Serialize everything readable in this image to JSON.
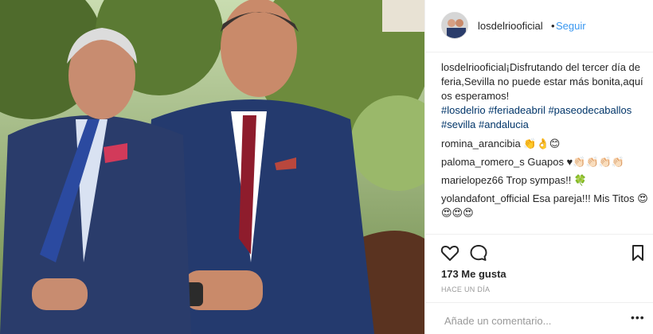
{
  "post": {
    "username": "losdelriooficial",
    "separator": "•",
    "follow_label": "Seguir",
    "caption_user": "losdelriooficial",
    "caption_text": "¡Disfrutando del tercer día de feria,Sevilla no puede estar más bonita,aquí os esperamos!",
    "hashtags": [
      "#losdelrio",
      "#feriadeabril",
      "#paseodecaballos",
      "#sevilla",
      "#andalucia"
    ],
    "comments": [
      {
        "user": "romina_arancibia",
        "text": "👏👌😊"
      },
      {
        "user": "paloma_romero_s",
        "text": "Guapos ♥👏🏻👏🏻👏🏻👏🏻"
      },
      {
        "user": "marielopez66",
        "text": "Trop sympas!! 🍀"
      },
      {
        "user": "yolandafont_official",
        "text": "Esa pareja!!! Mis Titos 😍😍😍😍"
      }
    ],
    "likes": "173 Me gusta",
    "time": "HACE UN DÍA",
    "add_comment_placeholder": "Añade un comentario...",
    "more_label": "•••"
  },
  "icons": {
    "like": "heart-icon",
    "comment": "speech-bubble-icon",
    "save": "bookmark-icon"
  },
  "colors": {
    "link": "#3897f0",
    "hashtag": "#003569",
    "text": "#262626",
    "muted": "#999999"
  }
}
